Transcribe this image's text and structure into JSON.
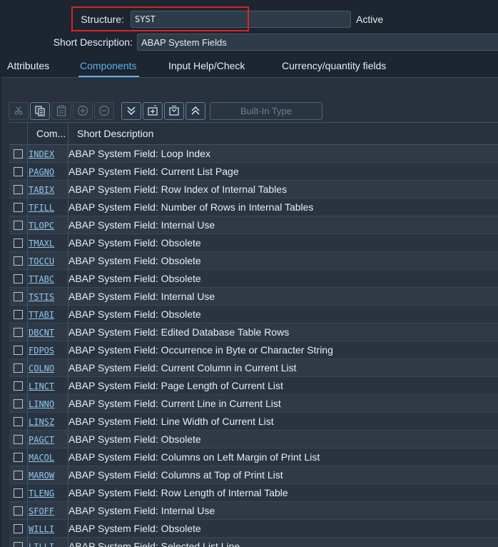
{
  "header": {
    "structure_label": "Structure:",
    "structure_value": "SYST",
    "status": "Active",
    "short_desc_label": "Short Description:",
    "short_desc_value": "ABAP System Fields"
  },
  "tabs": [
    {
      "label": "Attributes",
      "active": false
    },
    {
      "label": "Components",
      "active": true
    },
    {
      "label": "Input Help/Check",
      "active": false
    },
    {
      "label": "Currency/quantity fields",
      "active": false
    }
  ],
  "toolbar": {
    "builtin_label": "Built-In Type",
    "icons": [
      "scissors-icon",
      "copy-icon",
      "paste-icon",
      "insert-row-icon",
      "delete-row-icon",
      "expand-down-icon",
      "new-entry-icon",
      "select-entry-icon",
      "collapse-up-icon"
    ]
  },
  "table": {
    "col_name_header": "Com...",
    "col_desc_header": "Short Description",
    "rows": [
      {
        "name": "INDEX",
        "desc": "ABAP System Field: Loop Index"
      },
      {
        "name": "PAGNO",
        "desc": "ABAP System Field: Current List Page"
      },
      {
        "name": "TABIX",
        "desc": "ABAP System Field: Row Index of Internal Tables"
      },
      {
        "name": "TFILL",
        "desc": "ABAP System Field: Number of Rows in Internal Tables"
      },
      {
        "name": "TLOPC",
        "desc": "ABAP System Field: Internal Use"
      },
      {
        "name": "TMAXL",
        "desc": "ABAP System Field: Obsolete"
      },
      {
        "name": "TOCCU",
        "desc": "ABAP System Field: Obsolete"
      },
      {
        "name": "TTABC",
        "desc": "ABAP System Field: Obsolete"
      },
      {
        "name": "TSTIS",
        "desc": "ABAP System Field: Internal Use"
      },
      {
        "name": "TTABI",
        "desc": "ABAP System Field: Obsolete"
      },
      {
        "name": "DBCNT",
        "desc": "ABAP System Field: Edited Database Table Rows"
      },
      {
        "name": "FDPOS",
        "desc": "ABAP System Field: Occurrence in Byte or Character String"
      },
      {
        "name": "COLNO",
        "desc": "ABAP System Field: Current Column in Current List"
      },
      {
        "name": "LINCT",
        "desc": "ABAP System Field: Page Length of Current List"
      },
      {
        "name": "LINNO",
        "desc": "ABAP System Field: Current Line in Current List"
      },
      {
        "name": "LINSZ",
        "desc": "ABAP System Field: Line Width of Current List"
      },
      {
        "name": "PAGCT",
        "desc": "ABAP System Field: Obsolete"
      },
      {
        "name": "MACOL",
        "desc": "ABAP System Field: Columns on Left Margin of Print List"
      },
      {
        "name": "MAROW",
        "desc": "ABAP System Field: Columns at Top of Print List"
      },
      {
        "name": "TLENG",
        "desc": "ABAP System Field: Row Length of Internal Table"
      },
      {
        "name": "SFOFF",
        "desc": "ABAP System Field: Internal Use"
      },
      {
        "name": "WILLI",
        "desc": "ABAP System Field: Obsolete"
      },
      {
        "name": "LILLI",
        "desc": "ABAP System Field: Selected List Line"
      }
    ]
  }
}
